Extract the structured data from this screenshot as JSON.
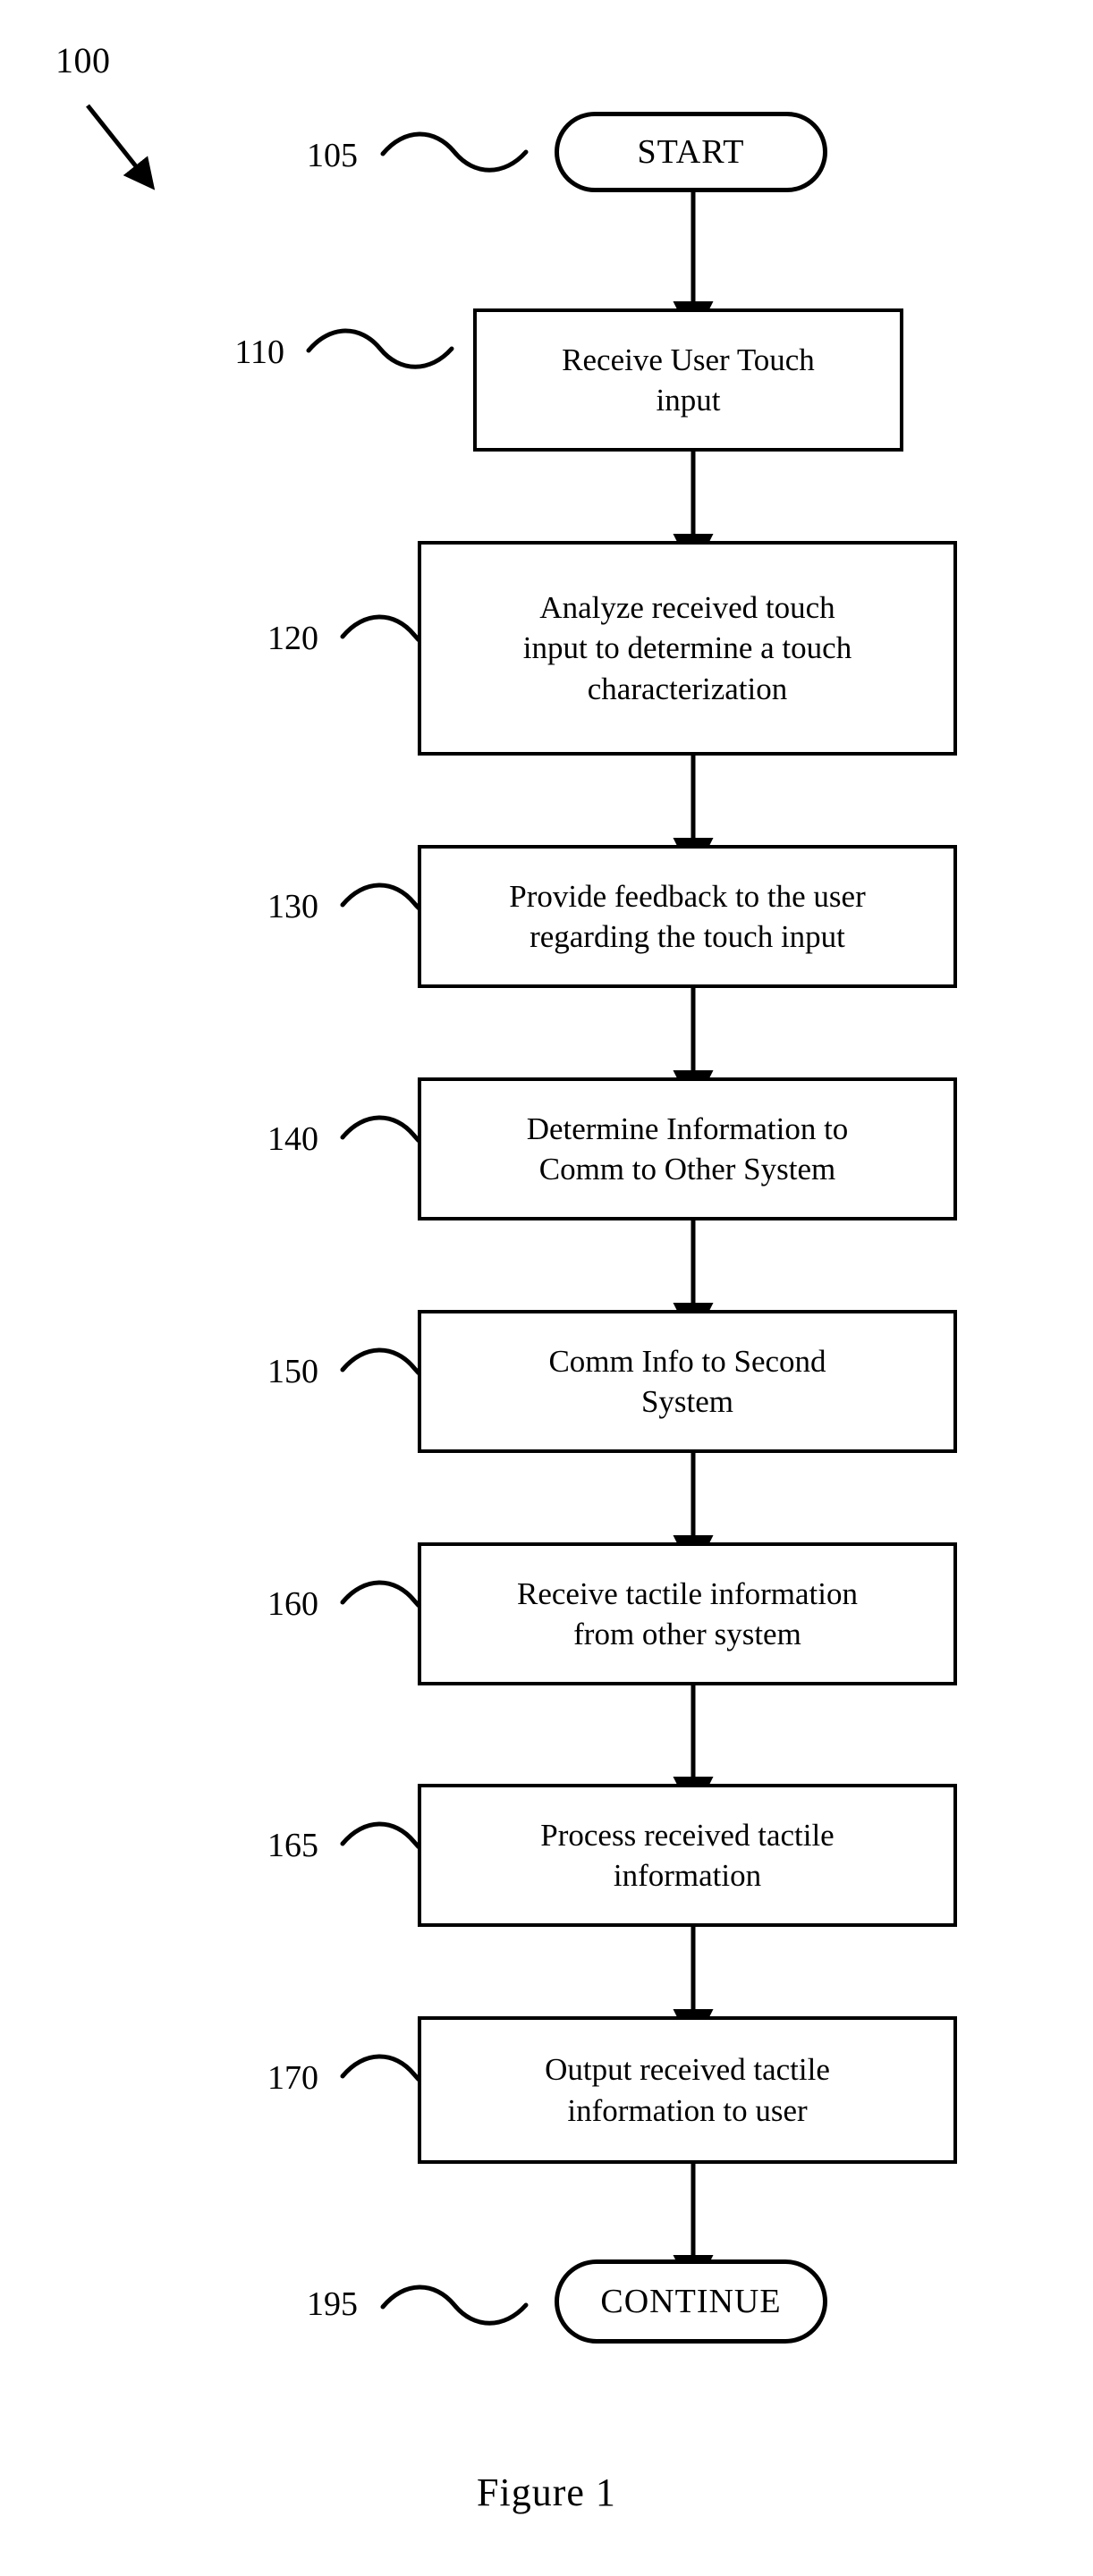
{
  "figure": {
    "caption": "Figure 1",
    "diagram_ref": "100",
    "type": "process-flowchart"
  },
  "nodes": [
    {
      "id": "start",
      "ref": "105",
      "shape": "terminator",
      "label": "START"
    },
    {
      "id": "step-110",
      "ref": "110",
      "shape": "process",
      "label": "Receive User Touch\ninput"
    },
    {
      "id": "step-120",
      "ref": "120",
      "shape": "process",
      "label": "Analyze received touch\ninput to determine a touch\ncharacterization"
    },
    {
      "id": "step-130",
      "ref": "130",
      "shape": "process",
      "label": "Provide feedback to the user\nregarding the touch input"
    },
    {
      "id": "step-140",
      "ref": "140",
      "shape": "process",
      "label": "Determine Information to\nComm to Other System"
    },
    {
      "id": "step-150",
      "ref": "150",
      "shape": "process",
      "label": "Comm Info to Second\nSystem"
    },
    {
      "id": "step-160",
      "ref": "160",
      "shape": "process",
      "label": "Receive tactile information\nfrom other system"
    },
    {
      "id": "step-165",
      "ref": "165",
      "shape": "process",
      "label": "Process received tactile\ninformation"
    },
    {
      "id": "step-170",
      "ref": "170",
      "shape": "process",
      "label": "Output received tactile\ninformation to user"
    },
    {
      "id": "continue",
      "ref": "195",
      "shape": "terminator",
      "label": "CONTINUE"
    }
  ],
  "edges": [
    {
      "from": "start",
      "to": "step-110",
      "arrow": "down"
    },
    {
      "from": "step-110",
      "to": "step-120",
      "arrow": "down"
    },
    {
      "from": "step-120",
      "to": "step-130",
      "arrow": "down"
    },
    {
      "from": "step-130",
      "to": "step-140",
      "arrow": "down"
    },
    {
      "from": "step-140",
      "to": "step-150",
      "arrow": "down"
    },
    {
      "from": "step-150",
      "to": "step-160",
      "arrow": "down"
    },
    {
      "from": "step-160",
      "to": "step-165",
      "arrow": "down"
    },
    {
      "from": "step-165",
      "to": "step-170",
      "arrow": "down"
    },
    {
      "from": "step-170",
      "to": "continue",
      "arrow": "down"
    }
  ],
  "style": {
    "ink": "#000000",
    "paper": "#ffffff"
  }
}
